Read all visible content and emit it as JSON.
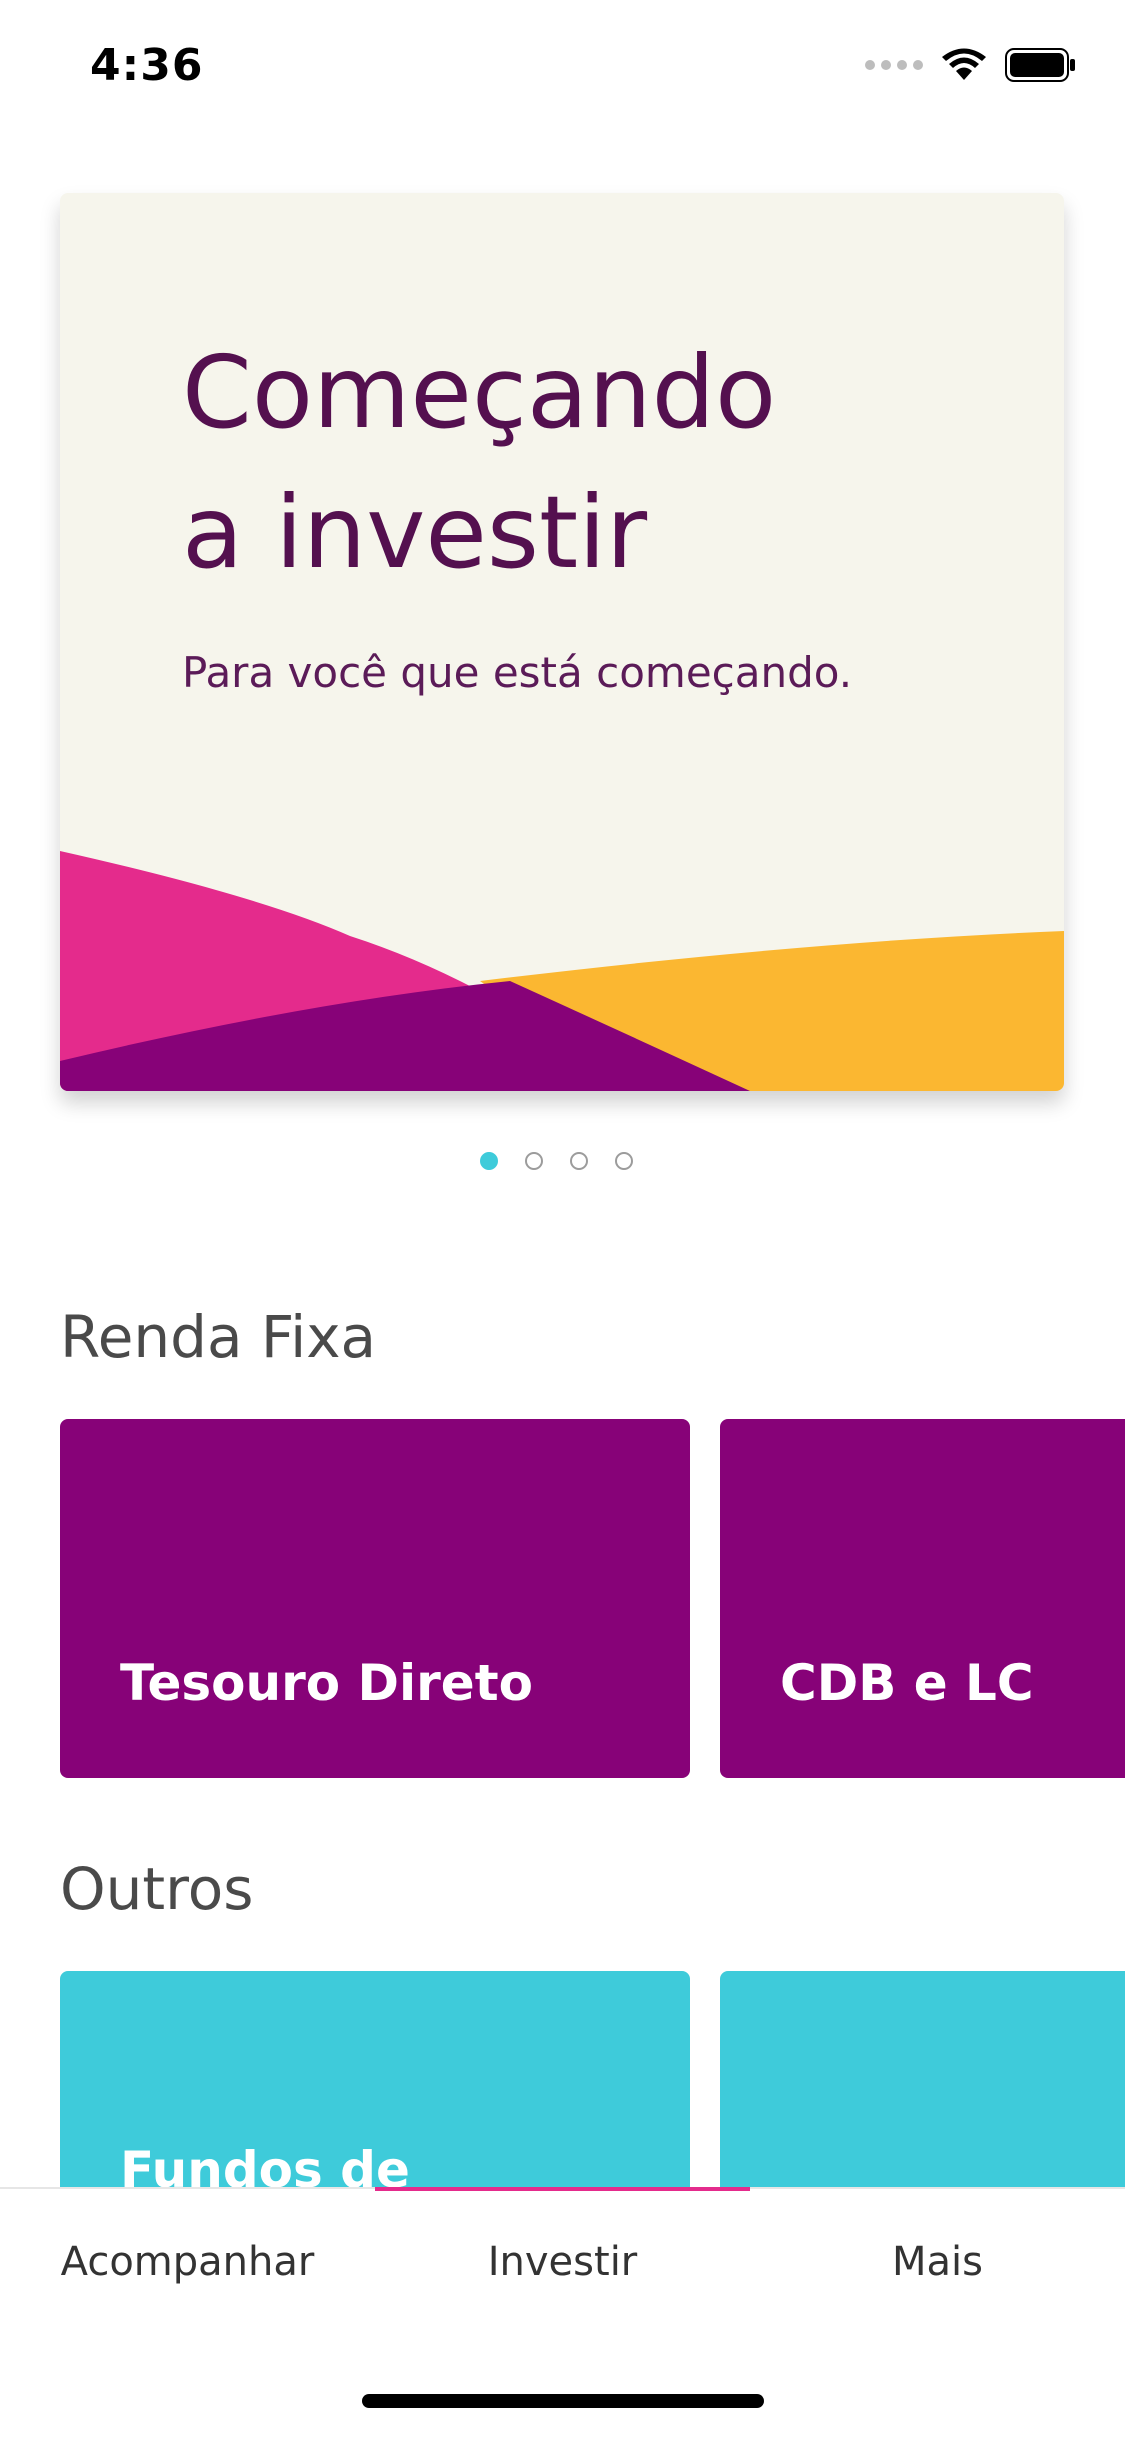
{
  "status_bar": {
    "time": "4:36"
  },
  "hero": {
    "title_line1": "Começando",
    "title_line2": "a investir",
    "subtitle": "Para você que está começando."
  },
  "pager": {
    "count": 4,
    "active_index": 0
  },
  "sections": {
    "renda_fixa": {
      "title": "Renda Fixa",
      "tiles": [
        "Tesouro Direto",
        "CDB e LC"
      ]
    },
    "outros": {
      "title": "Outros",
      "tiles": [
        "Fundos de",
        ""
      ]
    }
  },
  "tabs": [
    "Acompanhar",
    "Investir",
    "Mais"
  ],
  "active_tab": "Investir",
  "colors": {
    "purple": "#870278",
    "cyan": "#3ecbda",
    "magenta": "#e42b8c",
    "yellow": "#fbb731",
    "dark_purple": "#54104f"
  }
}
